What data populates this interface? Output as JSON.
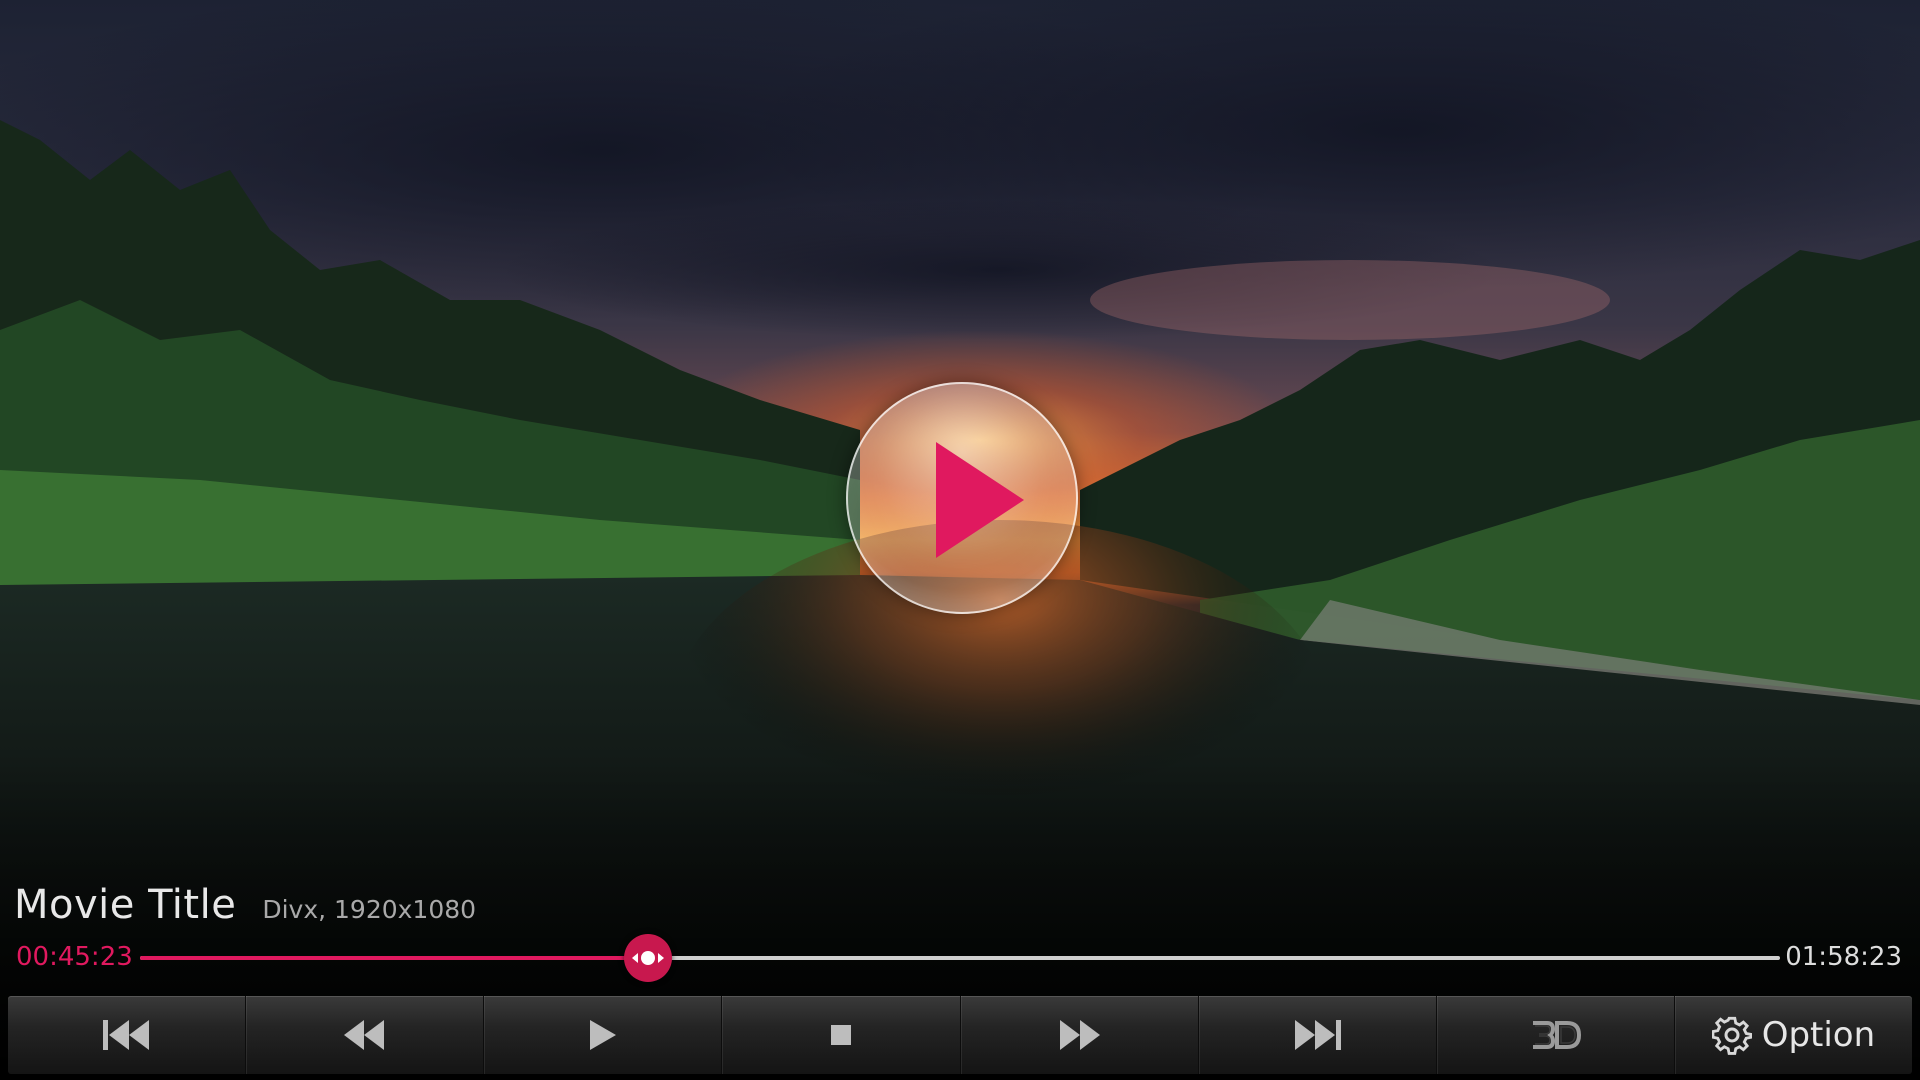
{
  "player": {
    "title": "Movie Title",
    "meta": "Divx, 1920x1080",
    "current_time": "00:45:23",
    "total_time": "01:58:23",
    "progress": 0.31
  },
  "controls": {
    "option_label": "Option"
  },
  "colors": {
    "accent": "#e0195f",
    "text_primary": "#e8e8e8",
    "text_secondary": "#a9a9a9",
    "bar_dark": "#1a1a1a"
  },
  "icons": [
    "play-overlay-icon",
    "skip-previous-icon",
    "rewind-icon",
    "play-icon",
    "stop-icon",
    "fast-forward-icon",
    "skip-next-icon",
    "3d-icon",
    "gear-icon"
  ]
}
